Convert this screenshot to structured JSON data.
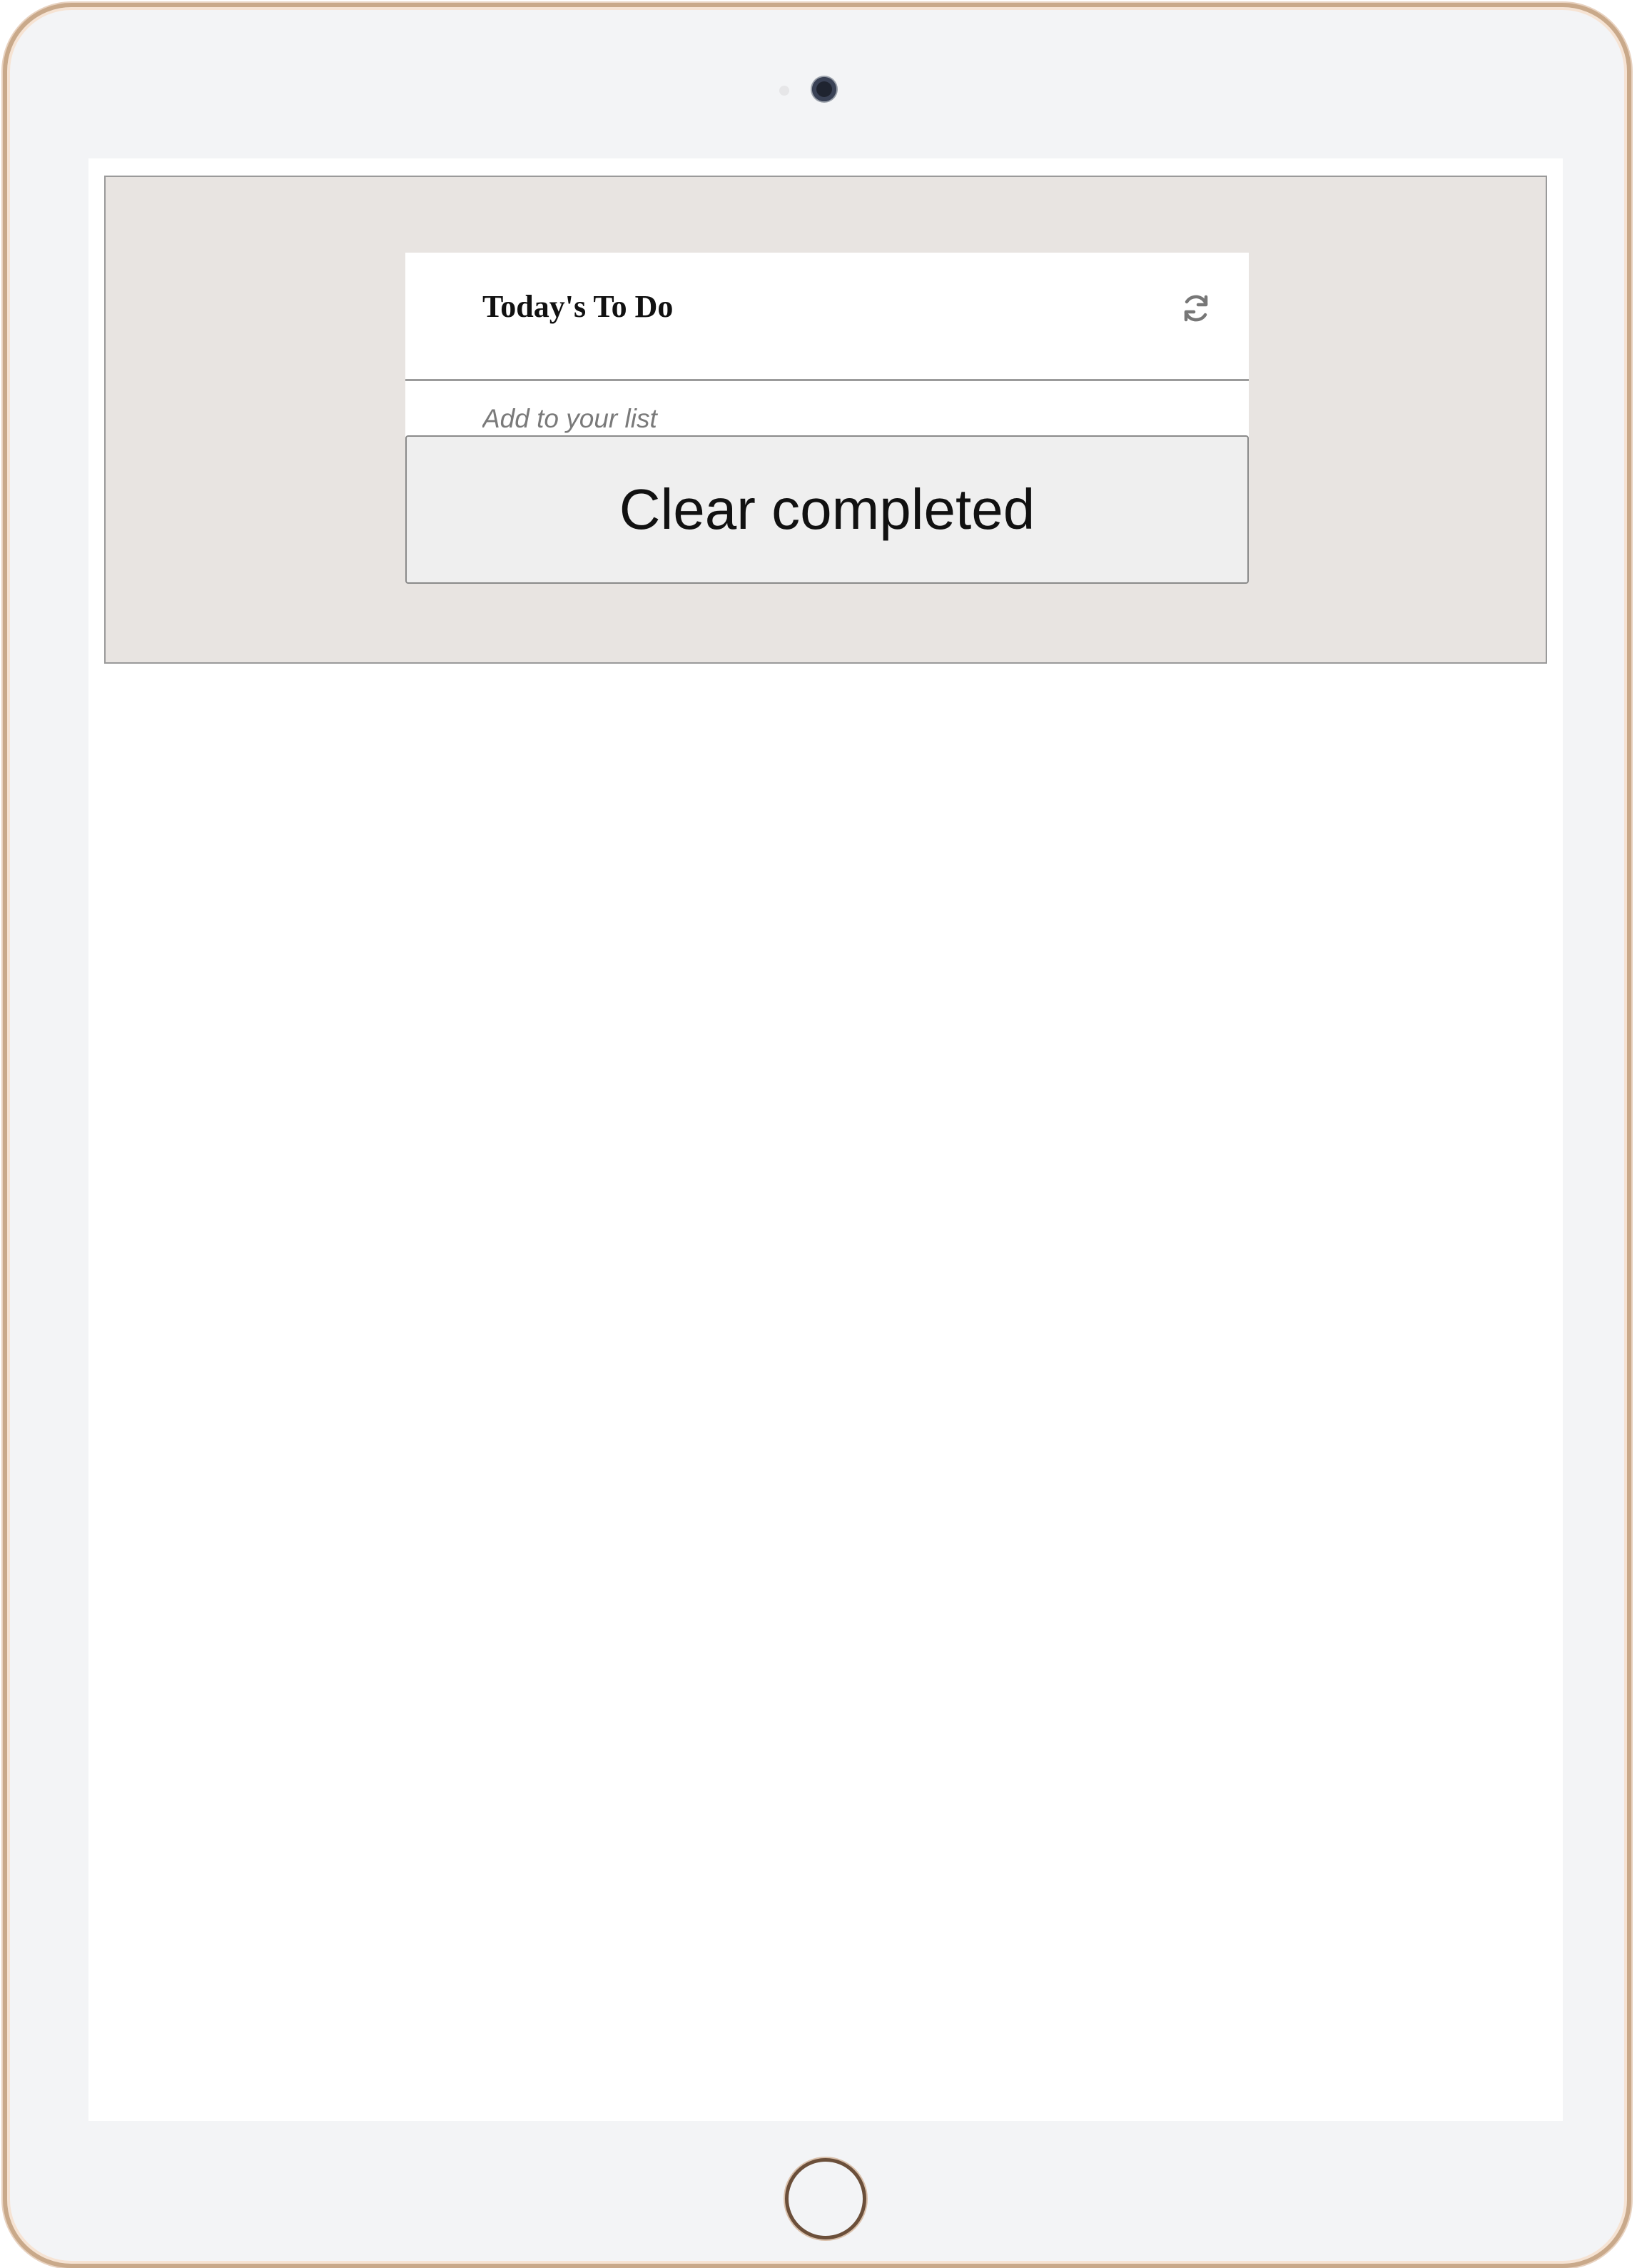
{
  "todo": {
    "title": "Today's To Do",
    "refresh_icon": "refresh-icon",
    "add_placeholder": "Add to your list",
    "clear_label": "Clear completed"
  }
}
